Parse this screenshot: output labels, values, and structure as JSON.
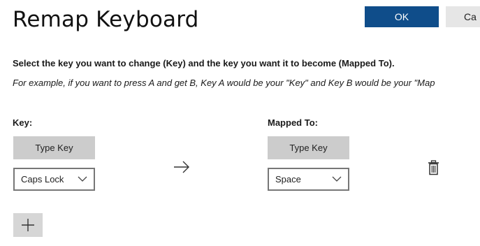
{
  "header": {
    "title": "Remap Keyboard",
    "ok_label": "OK",
    "cancel_label": "Ca"
  },
  "instructions": {
    "main": "Select the key you want to change (Key) and the key you want it to become (Mapped To).",
    "example": "For example, if you want to press A and get B, Key A would be your \"Key\" and Key B would be your \"Map"
  },
  "key_column": {
    "label": "Key:",
    "type_key_label": "Type Key",
    "selected": "Caps Lock"
  },
  "mapped_column": {
    "label": "Mapped To:",
    "type_key_label": "Type Key",
    "selected": "Space"
  },
  "icons": {
    "arrow": "right-arrow-icon",
    "delete": "trash-icon",
    "add": "plus-icon",
    "dropdown": "chevron-down-icon"
  },
  "colors": {
    "accent": "#0f4d8a",
    "button_gray": "#cccccc"
  }
}
